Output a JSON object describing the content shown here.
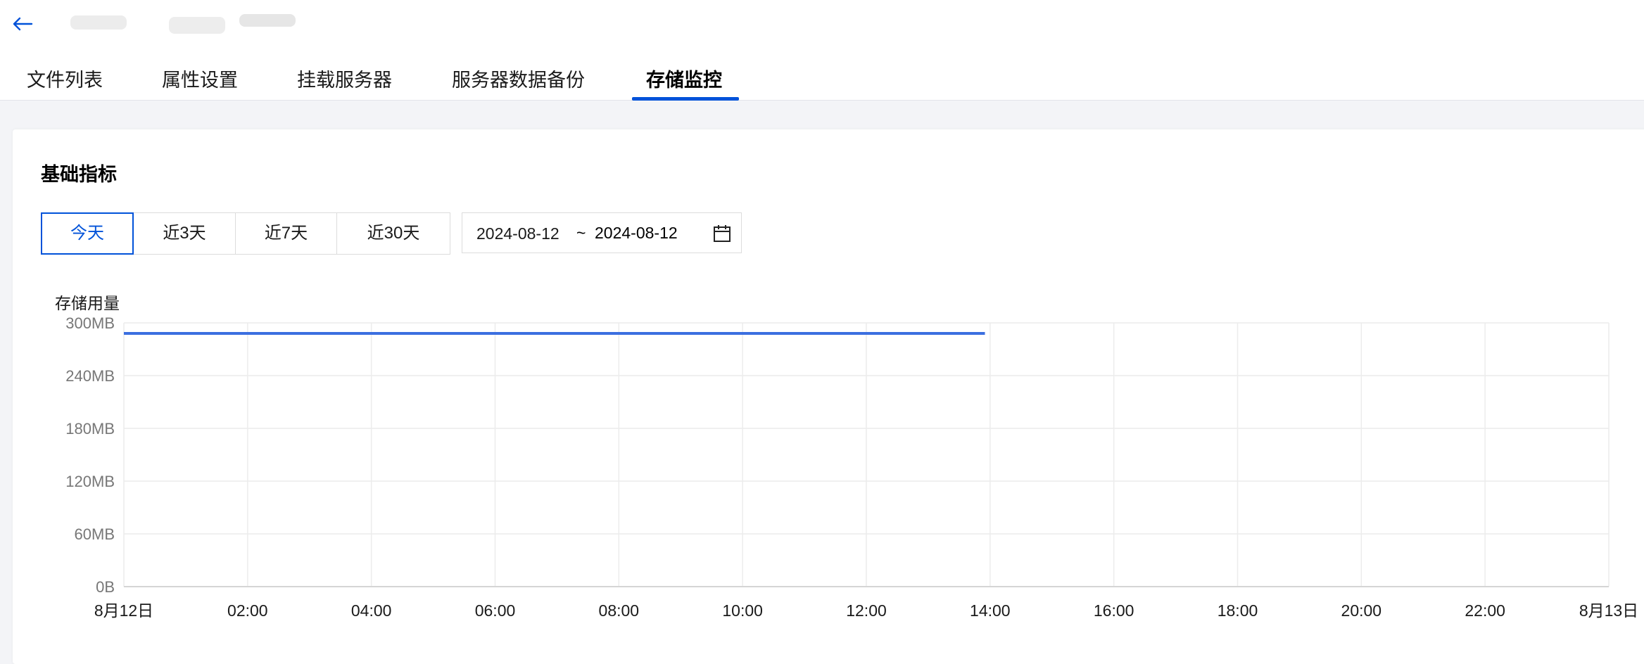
{
  "header": {
    "back_icon": "arrow-left-icon",
    "title": ""
  },
  "tabs": [
    {
      "label": "文件列表",
      "active": false
    },
    {
      "label": "属性设置",
      "active": false
    },
    {
      "label": "挂载服务器",
      "active": false
    },
    {
      "label": "服务器数据备份",
      "active": false
    },
    {
      "label": "存储监控",
      "active": true
    }
  ],
  "section": {
    "title": "基础指标"
  },
  "range_buttons": [
    {
      "label": "今天",
      "active": true
    },
    {
      "label": "近3天",
      "active": false
    },
    {
      "label": "近7天",
      "active": false
    },
    {
      "label": "近30天",
      "active": false
    }
  ],
  "date_range": {
    "start": "2024-08-12",
    "separator": "~",
    "end": "2024-08-12",
    "icon": "calendar-icon"
  },
  "colors": {
    "accent": "#0052d9",
    "series": "#3b6fe0",
    "grid": "#ececec"
  },
  "chart_data": {
    "type": "line",
    "title": "存储用量",
    "xlabel": "",
    "ylabel": "",
    "x_ticks": [
      "8月12日",
      "02:00",
      "04:00",
      "06:00",
      "08:00",
      "10:00",
      "12:00",
      "14:00",
      "16:00",
      "18:00",
      "20:00",
      "22:00",
      "8月13日"
    ],
    "y_ticks": [
      "300MB",
      "240MB",
      "180MB",
      "120MB",
      "60MB",
      "0B"
    ],
    "xlim_hours": [
      0,
      24
    ],
    "ylim_mb": [
      0,
      300
    ],
    "grid": true,
    "series": [
      {
        "x": [
          "00:00",
          "13:55"
        ],
        "y": [
          288,
          288
        ]
      }
    ]
  }
}
